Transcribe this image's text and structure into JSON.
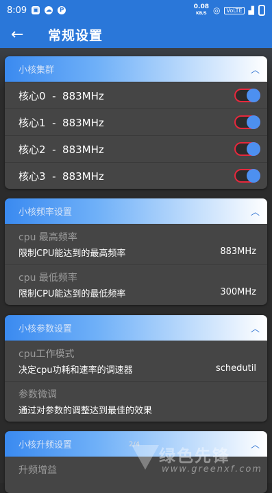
{
  "status_bar": {
    "time": "8:09",
    "icons": [
      "notification-icon",
      "cloud-icon",
      "p-icon"
    ],
    "speed_value": "0.08",
    "speed_unit": "KB/S",
    "volte": "VoLTE"
  },
  "app_bar": {
    "back_icon": "arrow-left-icon",
    "title": "常规设置"
  },
  "cluster_card": {
    "header": "小核集群",
    "cores": [
      {
        "label": "核心0  -  883MHz",
        "enabled": true
      },
      {
        "label": "核心1  -  883MHz",
        "enabled": true
      },
      {
        "label": "核心2  -  883MHz",
        "enabled": true
      },
      {
        "label": "核心3  -  883MHz",
        "enabled": true
      }
    ]
  },
  "freq_card": {
    "header": "小核频率设置",
    "rows": [
      {
        "label": "cpu 最高频率",
        "desc": "限制CPU能达到的最高频率",
        "value": "883MHz"
      },
      {
        "label": "cpu 最低频率",
        "desc": "限制CPU能达到的最低频率",
        "value": "300MHz"
      }
    ]
  },
  "param_card": {
    "header": "小核参数设置",
    "rows": [
      {
        "label": "cpu工作模式",
        "desc": "决定cpu功耗和速率的调速器",
        "value": "schedutil"
      },
      {
        "label": "参数微调",
        "desc": "通过对参数的调整达到最佳的效果",
        "value": ""
      }
    ]
  },
  "boost_card": {
    "header": "小核升频设置",
    "rows": [
      {
        "label": "升频增益"
      }
    ]
  },
  "watermark": {
    "text": "绿色先锋",
    "url": "www.greenxf.com",
    "pager": "2/4"
  },
  "colors": {
    "accent": "#2a77d9",
    "switch_border": "#e6283c",
    "knob": "#4d90f0"
  }
}
